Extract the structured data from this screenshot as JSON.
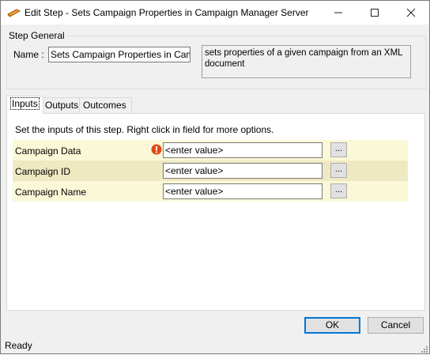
{
  "window": {
    "title": "Edit Step - Sets Campaign Properties in Campaign Manager Server",
    "app_icon": "step-icon",
    "controls": {
      "minimize": "minimize-icon",
      "maximize": "maximize-icon",
      "close": "close-icon"
    }
  },
  "step_general": {
    "group_title": "Step General",
    "name_label": "Name :",
    "name_value": "Sets Campaign Properties in Campaign Manager Server",
    "description": "sets properties of a given campaign from an XML document"
  },
  "tabs": [
    {
      "label": "Inputs",
      "active": true
    },
    {
      "label": "Outputs",
      "active": false
    },
    {
      "label": "Outcomes",
      "active": false
    }
  ],
  "inputs_panel": {
    "hint": "Set the inputs of this step.  Right click in field for more options.",
    "rows": [
      {
        "label": "Campaign Data",
        "value": "<enter value>",
        "button": "...",
        "required_error": true,
        "row_color": "#fbf8d8"
      },
      {
        "label": "Campaign ID",
        "value": "<enter value>",
        "button": "...",
        "required_error": false,
        "row_color": "#efe9c2"
      },
      {
        "label": "Campaign Name",
        "value": "<enter value>",
        "button": "...",
        "required_error": false,
        "row_color": "#fbf8d8"
      }
    ]
  },
  "buttons": {
    "ok": "OK",
    "cancel": "Cancel"
  },
  "status": {
    "text": "Ready"
  },
  "colors": {
    "accent": "#0078d7",
    "error_icon": "#e04a1a",
    "window_bg": "#f0f0f0"
  }
}
